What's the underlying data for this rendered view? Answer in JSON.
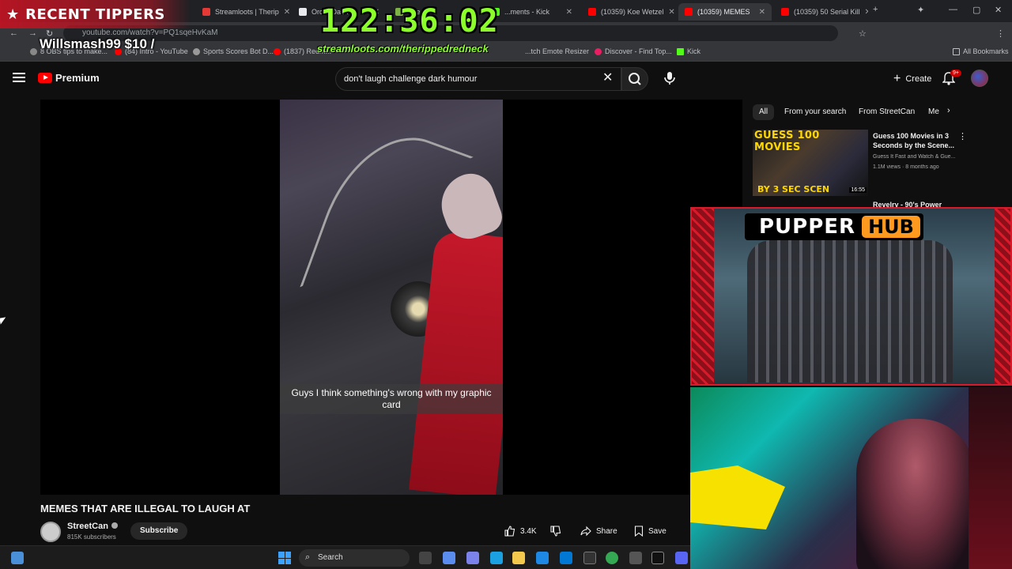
{
  "browser": {
    "tabs": [
      {
        "label": "Streamloots | Therip",
        "color": "#e53935"
      },
      {
        "label": "Order Dash",
        "color": "#e8eaed"
      },
      {
        "label": "The...",
        "color": "#7cb342"
      },
      {
        "label": "...ments - Kick",
        "color": "#53fc18"
      },
      {
        "label": "(10359) Koe Wetzel",
        "color": "#ff0000"
      },
      {
        "label": "(10359) MEMES",
        "color": "#ff0000"
      },
      {
        "label": "(10359) 50 Serial Kill",
        "color": "#ff0000"
      }
    ],
    "url": "youtube.com/watch?v=PQ1sqeHvKaM",
    "bookmarks": [
      "8 OBS tips to make...",
      "(84) Intro - YouTube",
      "Sports Scores Bot D...",
      "(1837) Redm...",
      "...tch Emote Resizer",
      "Discover - Find Top...",
      "Kick"
    ],
    "all_bookmarks": "All Bookmarks"
  },
  "overlay": {
    "tippers_label": "RECENT TIPPERS",
    "tipper_entry": "Willsmash99 $10 /",
    "timer": "122:36:02",
    "streamloots_url": "streamloots.com/therippedredneck",
    "pupper_left": "PUPPER",
    "pupper_right": "HUB"
  },
  "youtube": {
    "brand": "Premium",
    "search_query": "don't laugh challenge dark humour",
    "create_label": "Create",
    "notif_count": "9+",
    "video": {
      "caption": "Guys I think something's wrong with my graphic card",
      "title": "MEMES THAT ARE ILLEGAL TO LAUGH AT",
      "channel": "StreetCan",
      "subscribers": "815K subscribers",
      "subscribe_label": "Subscribe",
      "likes": "3.4K",
      "share_label": "Share",
      "save_label": "Save"
    },
    "chips": [
      "All",
      "From your search",
      "From StreetCan",
      "Me"
    ],
    "recommendations": [
      {
        "thumb_top": "GUESS 100 MOVIES",
        "thumb_bottom": "BY 3 SEC SCEN",
        "duration": "16:55",
        "title": "Guess 100 Movies in 3 Seconds by the Scene...",
        "channel": "Guess It Fast and Watch & Gue...",
        "meta": "1.1M views · 8 months ago"
      },
      {
        "title": "Revelry - 90's Power"
      }
    ]
  },
  "taskbar": {
    "search_label": "Search"
  }
}
